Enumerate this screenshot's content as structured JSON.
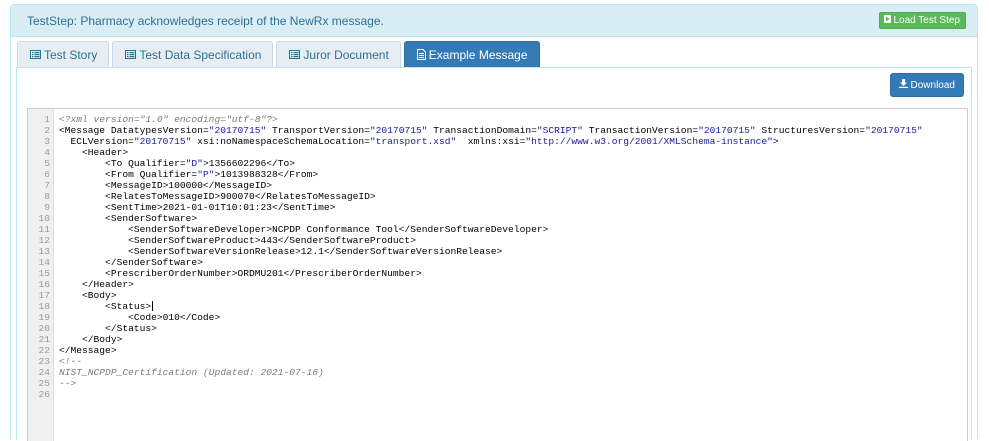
{
  "panel": {
    "title": "TestStep: Pharmacy acknowledges receipt of the NewRx message.",
    "load_button_label": "Load Test Step"
  },
  "tabs": [
    {
      "label": "Test Story",
      "icon": "list-alt-icon",
      "active": false
    },
    {
      "label": "Test Data Specification",
      "icon": "list-alt-icon",
      "active": false
    },
    {
      "label": "Juror Document",
      "icon": "list-alt-icon",
      "active": false
    },
    {
      "label": "Example Message",
      "icon": "file-text-icon",
      "active": true
    }
  ],
  "download_button_label": "Download",
  "editor": {
    "line_numbers": [
      "1",
      "2",
      "3",
      "4",
      "5",
      "6",
      "7",
      "8",
      "9",
      "10",
      "11",
      "12",
      "13",
      "14",
      "15",
      "16",
      "17",
      "18",
      "19",
      "20",
      "21",
      "22",
      "23",
      "24",
      "25",
      "26"
    ],
    "lines": [
      "<?xml version=\"1.0\" encoding=\"utf-8\"?>",
      "<Message DatatypesVersion=\"20170715\" TransportVersion=\"20170715\" TransactionDomain=\"SCRIPT\" TransactionVersion=\"20170715\" StructuresVersion=\"20170715\"",
      "  ECLVersion=\"20170715\" xsi:noNamespaceSchemaLocation=\"transport.xsd\"  xmlns:xsi=\"http://www.w3.org/2001/XMLSchema-instance\">",
      "    <Header>",
      "        <To Qualifier=\"D\">1356602296</To>",
      "        <From Qualifier=\"P\">1013988328</From>",
      "        <MessageID>100000</MessageID>",
      "        <RelatesToMessageID>900070</RelatesToMessageID>",
      "        <SentTime>2021-01-01T10:01:23</SentTime>",
      "        <SenderSoftware>",
      "            <SenderSoftwareDeveloper>NCPDP Conformance Tool</SenderSoftwareDeveloper>",
      "            <SenderSoftwareProduct>443</SenderSoftwareProduct>",
      "            <SenderSoftwareVersionRelease>12.1</SenderSoftwareVersionRelease>",
      "        </SenderSoftware>",
      "        <PrescriberOrderNumber>ORDMU201</PrescriberOrderNumber>",
      "    </Header>",
      "    <Body>",
      "        <Status>",
      "            <Code>010</Code>",
      "        </Status>",
      "    </Body>",
      "</Message>",
      "<!--",
      "NIST_NCPDP_Certification (Updated: 2021-07-16)",
      "-->",
      ""
    ],
    "comment_lines": [
      0,
      22,
      23,
      24
    ],
    "cursor_line": 17
  },
  "colors": {
    "heading_bg": "#d9edf7",
    "heading_text": "#31708f",
    "load_button": "#5cb85c",
    "tab_active": "#337ab7",
    "tab_inactive": "#e6eef4",
    "download_button": "#337ab7",
    "attribute_value": "#1a1aa6",
    "comment": "#7a7a7a"
  }
}
